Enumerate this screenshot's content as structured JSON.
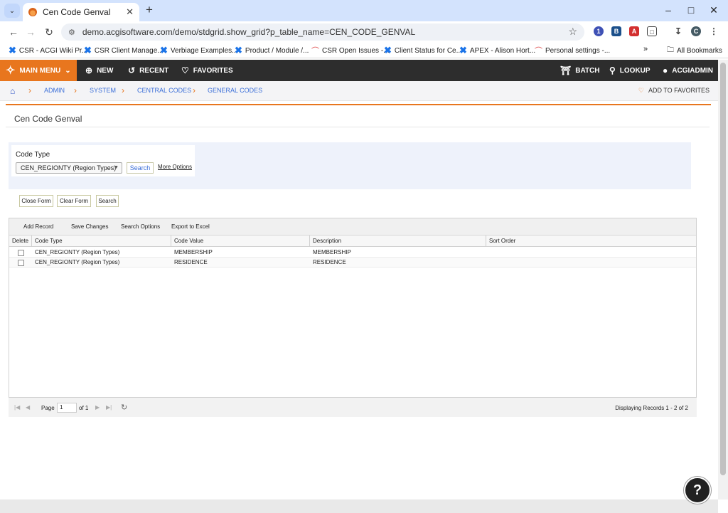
{
  "browser": {
    "tab_title": "Cen Code Genval",
    "url": "demo.acgisoftware.com/demo/stdgrid.show_grid?p_table_name=CEN_CODE_GENVAL",
    "profile_initial": "C",
    "bookmarks": [
      "CSR - ACGI Wiki Pr...",
      "CSR Client Manage...",
      "Verbiage Examples...",
      "Product / Module /...",
      "CSR Open Issues -...",
      "Client Status for Ce...",
      "APEX - Alison Hort...",
      "Personal settings -..."
    ],
    "all_bookmarks": "All Bookmarks",
    "more_bookmarks": "»"
  },
  "appnav": {
    "main_menu": "MAIN MENU",
    "new": "NEW",
    "recent": "RECENT",
    "favorites": "FAVORITES",
    "batch": "BATCH",
    "lookup": "LOOKUP",
    "user": "ACGIADMIN"
  },
  "breadcrumb": {
    "items": [
      "ADMIN",
      "SYSTEM",
      "CENTRAL CODES",
      "GENERAL CODES"
    ],
    "add_to_favorites": "ADD TO FAVORITES"
  },
  "page": {
    "title": "Cen Code Genval"
  },
  "filter": {
    "label": "Code Type",
    "selected": "CEN_REGIONTY (Region Types)",
    "search_btn": "Search",
    "more_options": "More Options"
  },
  "form_buttons": {
    "close": "Close Form",
    "clear": "Clear Form",
    "search": "Search"
  },
  "grid": {
    "toolbar": [
      "Add Record",
      "Save Changes",
      "Search Options",
      "Export to Excel"
    ],
    "columns": [
      "Delete",
      "Code Type",
      "Code Value",
      "Description",
      "Sort Order"
    ],
    "rows": [
      {
        "code_type": "CEN_REGIONTY (Region Types)",
        "code_value": "MEMBERSHIP",
        "description": "MEMBERSHIP",
        "sort_order": ""
      },
      {
        "code_type": "CEN_REGIONTY (Region Types)",
        "code_value": "RESIDENCE",
        "description": "RESIDENCE",
        "sort_order": ""
      }
    ]
  },
  "pager": {
    "page_label": "Page",
    "page_value": "1",
    "of_label": "of 1",
    "status": "Displaying Records 1 - 2 of 2"
  },
  "help_label": "?"
}
